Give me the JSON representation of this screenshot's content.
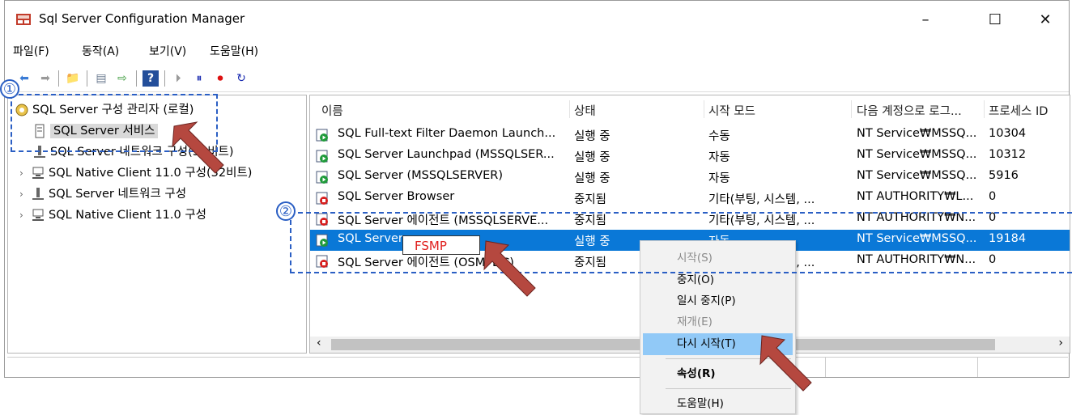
{
  "window": {
    "title": "Sql Server Configuration Manager"
  },
  "menu": [
    "파일(F)",
    "동작(A)",
    "보기(V)",
    "도움말(H)"
  ],
  "tree": {
    "items": [
      {
        "label": "SQL Server 구성 관리자 (로컬)",
        "icon": "config-manager-icon"
      },
      {
        "label": "SQL Server 서비스",
        "icon": "server-icon",
        "selected": true
      },
      {
        "label": "SQL Server 네트워크 구성(32비트)",
        "icon": "network-icon"
      },
      {
        "label": "SQL Native Client 11.0 구성(32비트)",
        "icon": "client-icon"
      },
      {
        "label": "SQL Server 네트워크 구성",
        "icon": "network-icon"
      },
      {
        "label": "SQL Native Client 11.0 구성",
        "icon": "client-icon"
      }
    ]
  },
  "list": {
    "headers": [
      "이름",
      "상태",
      "시작 모드",
      "다음 계정으로 로그...",
      "프로세스 ID"
    ],
    "rows": [
      {
        "name": "SQL Full-text Filter Daemon Launch...",
        "state": "실행 중",
        "mode": "수동",
        "account": "NT Service₩MSSQ...",
        "pid": "10304",
        "status": "running"
      },
      {
        "name": "SQL Server Launchpad (MSSQLSER...",
        "state": "실행 중",
        "mode": "자동",
        "account": "NT Service₩MSSQ...",
        "pid": "10312",
        "status": "running"
      },
      {
        "name": "SQL Server (MSSQLSERVER)",
        "state": "실행 중",
        "mode": "자동",
        "account": "NT Service₩MSSQ...",
        "pid": "5916",
        "status": "running"
      },
      {
        "name": "SQL Server Browser",
        "state": "중지됨",
        "mode": "기타(부팅, 시스템, ...",
        "account": "NT AUTHORITY₩L...",
        "pid": "0",
        "status": "stopped"
      },
      {
        "name": "SQL Server 에이전트 (MSSQLSERVE...",
        "state": "중지됨",
        "mode": "기타(부팅, 시스템, ...",
        "account": "NT AUTHORITY₩N...",
        "pid": "0",
        "status": "stopped"
      },
      {
        "name": "SQL Server",
        "state": "실행 중",
        "mode": "자동",
        "account": "NT Service₩MSSQ...",
        "pid": "19184",
        "status": "running",
        "selected": true
      },
      {
        "name": "SQL Server 에이전트 (OSMPDC)",
        "state": "중지됨",
        "mode": "기타(부팅, 시스템, ...",
        "account": "NT AUTHORITY₩N...",
        "pid": "0",
        "status": "stopped"
      }
    ]
  },
  "rename_value": "FSMP",
  "context_menu": [
    {
      "label": "시작(S)",
      "disabled": true
    },
    {
      "label": "중지(O)"
    },
    {
      "label": "일시 중지(P)"
    },
    {
      "label": "재개(E)",
      "disabled": true
    },
    {
      "label": "다시 시작(T)",
      "highlighted": true
    },
    {
      "label": "속성(R)",
      "bold": true
    },
    {
      "label": "도움말(H)"
    }
  ],
  "annotations": {
    "marker1": "①",
    "marker2": "②"
  },
  "colors": {
    "selection": "#0a78d7",
    "menu_highlight": "#91c9f7",
    "annotation_blue": "#2b5fc4",
    "arrow_red": "#b5483f"
  }
}
